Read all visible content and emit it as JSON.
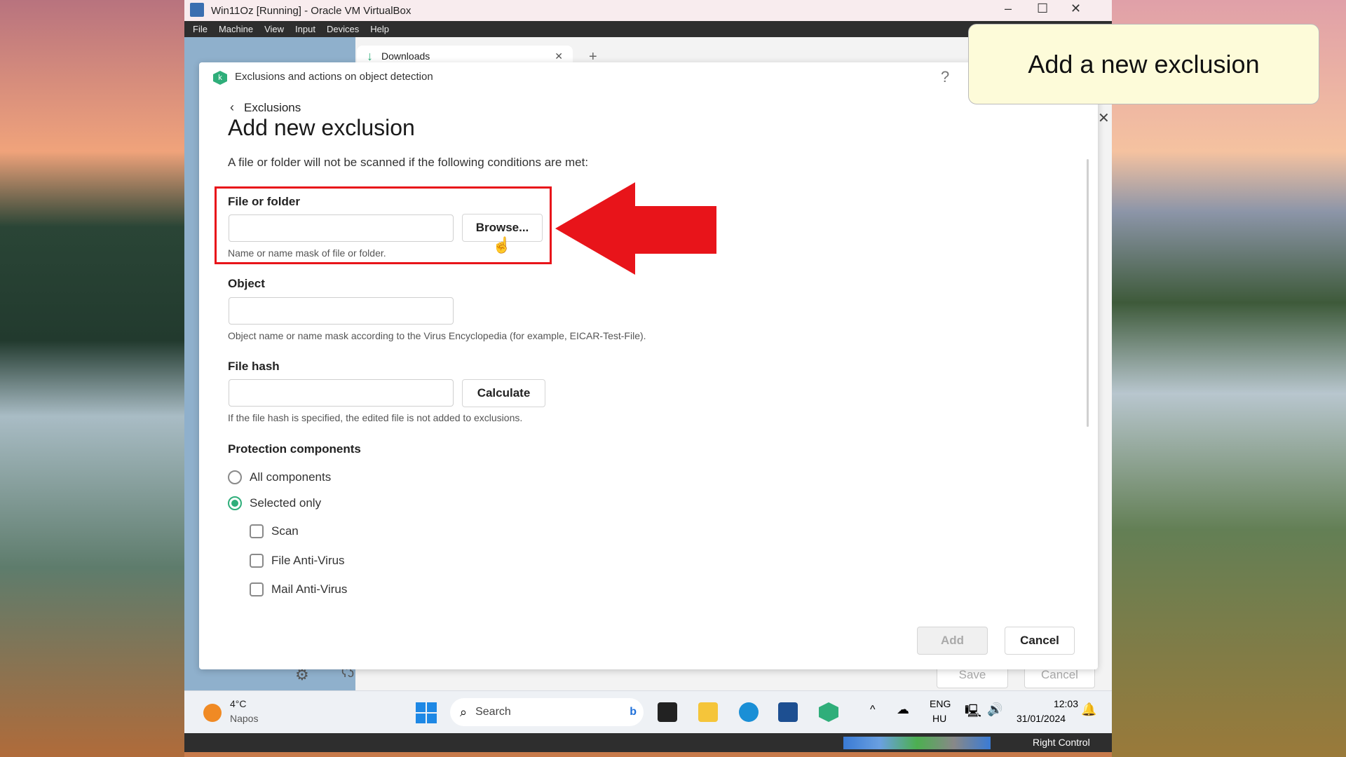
{
  "vm": {
    "title": "Win11Oz [Running] - Oracle VM VirtualBox",
    "menu": [
      "File",
      "Machine",
      "View",
      "Input",
      "Devices",
      "Help"
    ],
    "status_key": "Right Control"
  },
  "browser": {
    "tab_label": "Downloads"
  },
  "dialog": {
    "header": "Exclusions and actions on object detection",
    "help": "?",
    "back_label": "Exclusions",
    "title": "Add new exclusion",
    "description": "A file or folder will not be scanned if the following conditions are met:",
    "file_folder": {
      "label": "File or folder",
      "value": "",
      "button": "Browse...",
      "help": "Name or name mask of file or folder."
    },
    "object": {
      "label": "Object",
      "value": "",
      "help": "Object name or name mask according to the Virus Encyclopedia (for example, EICAR-Test-File)."
    },
    "file_hash": {
      "label": "File hash",
      "value": "",
      "button": "Calculate",
      "help": "If the file hash is specified, the edited file is not added to exclusions."
    },
    "protection": {
      "label": "Protection components",
      "radios": [
        {
          "label": "All components",
          "checked": false
        },
        {
          "label": "Selected only",
          "checked": true
        }
      ],
      "checkboxes": [
        {
          "label": "Scan",
          "checked": false
        },
        {
          "label": "File Anti-Virus",
          "checked": false
        },
        {
          "label": "Mail Anti-Virus",
          "checked": false
        }
      ]
    },
    "add": "Add",
    "cancel": "Cancel"
  },
  "background_app": {
    "save": "Save",
    "cancel": "Cancel"
  },
  "callout": "Add a new exclusion",
  "taskbar": {
    "temp": "4°C",
    "weather": "Napos",
    "search": "Search",
    "lang1": "ENG",
    "lang2": "HU",
    "time": "12:03",
    "date": "31/01/2024"
  },
  "colors": {
    "accent": "#2fae7a",
    "highlight": "#e8141a",
    "callout_bg": "#fdfbd9"
  }
}
